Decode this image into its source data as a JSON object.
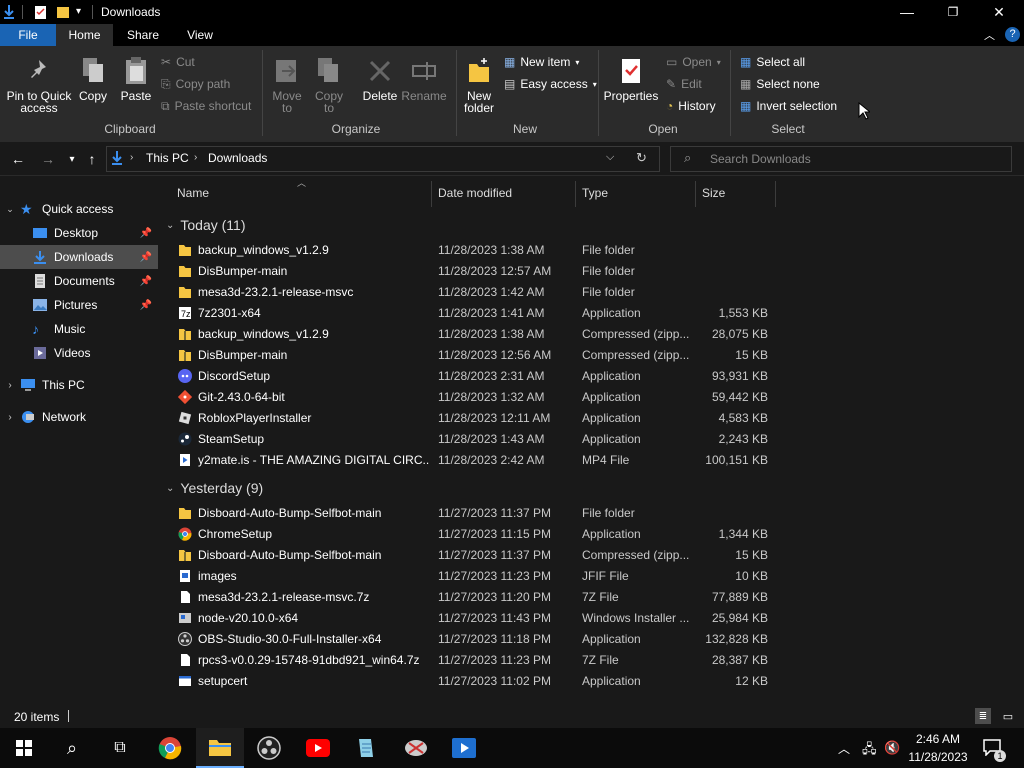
{
  "window": {
    "title": "Downloads"
  },
  "ribbon_tabs": [
    "File",
    "Home",
    "Share",
    "View"
  ],
  "ribbon": {
    "clipboard": {
      "pin": "Pin to Quick access",
      "copy": "Copy",
      "paste": "Paste",
      "cut": "Cut",
      "copy_path": "Copy path",
      "paste_shortcut": "Paste shortcut",
      "label": "Clipboard"
    },
    "organize": {
      "move_to": "Move to",
      "copy_to": "Copy to",
      "delete": "Delete",
      "rename": "Rename",
      "label": "Organize"
    },
    "new": {
      "new_folder": "New folder",
      "new_item": "New item",
      "easy_access": "Easy access",
      "label": "New"
    },
    "open": {
      "properties": "Properties",
      "open": "Open",
      "edit": "Edit",
      "history": "History",
      "label": "Open"
    },
    "select": {
      "select_all": "Select all",
      "select_none": "Select none",
      "invert": "Invert selection",
      "label": "Select"
    }
  },
  "address": {
    "this_pc": "This PC",
    "current": "Downloads",
    "search_placeholder": "Search Downloads"
  },
  "nav": {
    "quick_access": "Quick access",
    "items": [
      "Desktop",
      "Downloads",
      "Documents",
      "Pictures",
      "Music",
      "Videos"
    ],
    "this_pc": "This PC",
    "network": "Network"
  },
  "columns": {
    "name": "Name",
    "date": "Date modified",
    "type": "Type",
    "size": "Size"
  },
  "groups": [
    {
      "label": "Today (11)",
      "files": [
        {
          "name": "backup_windows_v1.2.9",
          "date": "11/28/2023 1:38 AM",
          "type": "File folder",
          "size": "",
          "icon": "folder"
        },
        {
          "name": "DisBumper-main",
          "date": "11/28/2023 12:57 AM",
          "type": "File folder",
          "size": "",
          "icon": "folder"
        },
        {
          "name": "mesa3d-23.2.1-release-msvc",
          "date": "11/28/2023 1:42 AM",
          "type": "File folder",
          "size": "",
          "icon": "folder"
        },
        {
          "name": "7z2301-x64",
          "date": "11/28/2023 1:41 AM",
          "type": "Application",
          "size": "1,553 KB",
          "icon": "7zip"
        },
        {
          "name": "backup_windows_v1.2.9",
          "date": "11/28/2023 1:38 AM",
          "type": "Compressed (zipp...",
          "size": "28,075 KB",
          "icon": "zip"
        },
        {
          "name": "DisBumper-main",
          "date": "11/28/2023 12:56 AM",
          "type": "Compressed (zipp...",
          "size": "15 KB",
          "icon": "zip"
        },
        {
          "name": "DiscordSetup",
          "date": "11/28/2023 2:31 AM",
          "type": "Application",
          "size": "93,931 KB",
          "icon": "discord"
        },
        {
          "name": "Git-2.43.0-64-bit",
          "date": "11/28/2023 1:32 AM",
          "type": "Application",
          "size": "59,442 KB",
          "icon": "git"
        },
        {
          "name": "RobloxPlayerInstaller",
          "date": "11/28/2023 12:11 AM",
          "type": "Application",
          "size": "4,583 KB",
          "icon": "roblox"
        },
        {
          "name": "SteamSetup",
          "date": "11/28/2023 1:43 AM",
          "type": "Application",
          "size": "2,243 KB",
          "icon": "steam"
        },
        {
          "name": "y2mate.is - THE AMAZING DIGITAL CIRC...",
          "date": "11/28/2023 2:42 AM",
          "type": "MP4 File",
          "size": "100,151 KB",
          "icon": "video"
        }
      ]
    },
    {
      "label": "Yesterday (9)",
      "files": [
        {
          "name": "Disboard-Auto-Bump-Selfbot-main",
          "date": "11/27/2023 11:37 PM",
          "type": "File folder",
          "size": "",
          "icon": "folder"
        },
        {
          "name": "ChromeSetup",
          "date": "11/27/2023 11:15 PM",
          "type": "Application",
          "size": "1,344 KB",
          "icon": "chrome"
        },
        {
          "name": "Disboard-Auto-Bump-Selfbot-main",
          "date": "11/27/2023 11:37 PM",
          "type": "Compressed (zipp...",
          "size": "15 KB",
          "icon": "zip"
        },
        {
          "name": "images",
          "date": "11/27/2023 11:23 PM",
          "type": "JFIF File",
          "size": "10 KB",
          "icon": "image"
        },
        {
          "name": "mesa3d-23.2.1-release-msvc.7z",
          "date": "11/27/2023 11:20 PM",
          "type": "7Z File",
          "size": "77,889 KB",
          "icon": "file"
        },
        {
          "name": "node-v20.10.0-x64",
          "date": "11/27/2023 11:43 PM",
          "type": "Windows Installer ...",
          "size": "25,984 KB",
          "icon": "msi"
        },
        {
          "name": "OBS-Studio-30.0-Full-Installer-x64",
          "date": "11/27/2023 11:18 PM",
          "type": "Application",
          "size": "132,828 KB",
          "icon": "obs"
        },
        {
          "name": "rpcs3-v0.0.29-15748-91dbd921_win64.7z",
          "date": "11/27/2023 11:23 PM",
          "type": "7Z File",
          "size": "28,387 KB",
          "icon": "file"
        },
        {
          "name": "setupcert",
          "date": "11/27/2023 11:02 PM",
          "type": "Application",
          "size": "12 KB",
          "icon": "app"
        }
      ]
    }
  ],
  "status": {
    "count": "20 items"
  },
  "taskbar": {
    "time": "2:46 AM",
    "date": "11/28/2023",
    "notification_count": "1"
  },
  "colors": {
    "accent": "#1a64b4",
    "folder": "#f5c542",
    "bg": "#191919",
    "ribbon": "#2b2b2b",
    "selected": "#4d4d4d"
  }
}
